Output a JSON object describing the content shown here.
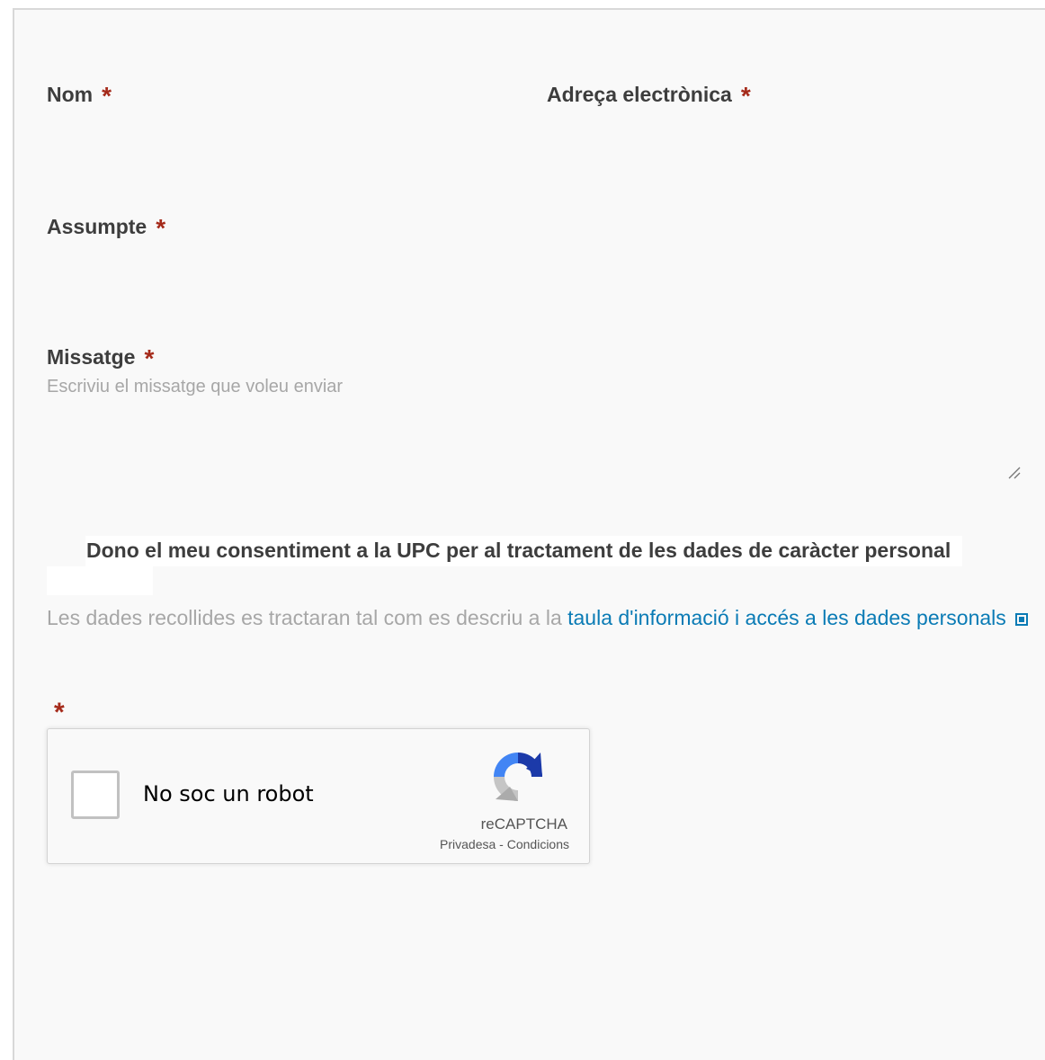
{
  "form": {
    "name": {
      "label": "Nom",
      "required": "*"
    },
    "email": {
      "label": "Adreça electrònica",
      "required": "*"
    },
    "subject": {
      "label": "Assumpte",
      "required": "*"
    },
    "message": {
      "label": "Missatge",
      "required": "*",
      "placeholder": "Escriviu el missatge que voleu enviar"
    },
    "consent": {
      "label": "Dono el meu consentiment a la UPC per al tractament de les dades de caràcter personal",
      "info_prefix": "Les dades recollides es tractaran tal com es descriu a la ",
      "info_link": "taula d'informació i accés a les dades personals"
    },
    "captcha": {
      "required": "*",
      "label": "No soc un robot",
      "brand": "reCAPTCHA",
      "privacy": "Privadesa",
      "separator": " - ",
      "terms": "Condicions"
    }
  },
  "colors": {
    "required": "#a52a1a",
    "link": "#0a7bb5",
    "label": "#3d3d3d",
    "hint": "#a7a7a7"
  }
}
